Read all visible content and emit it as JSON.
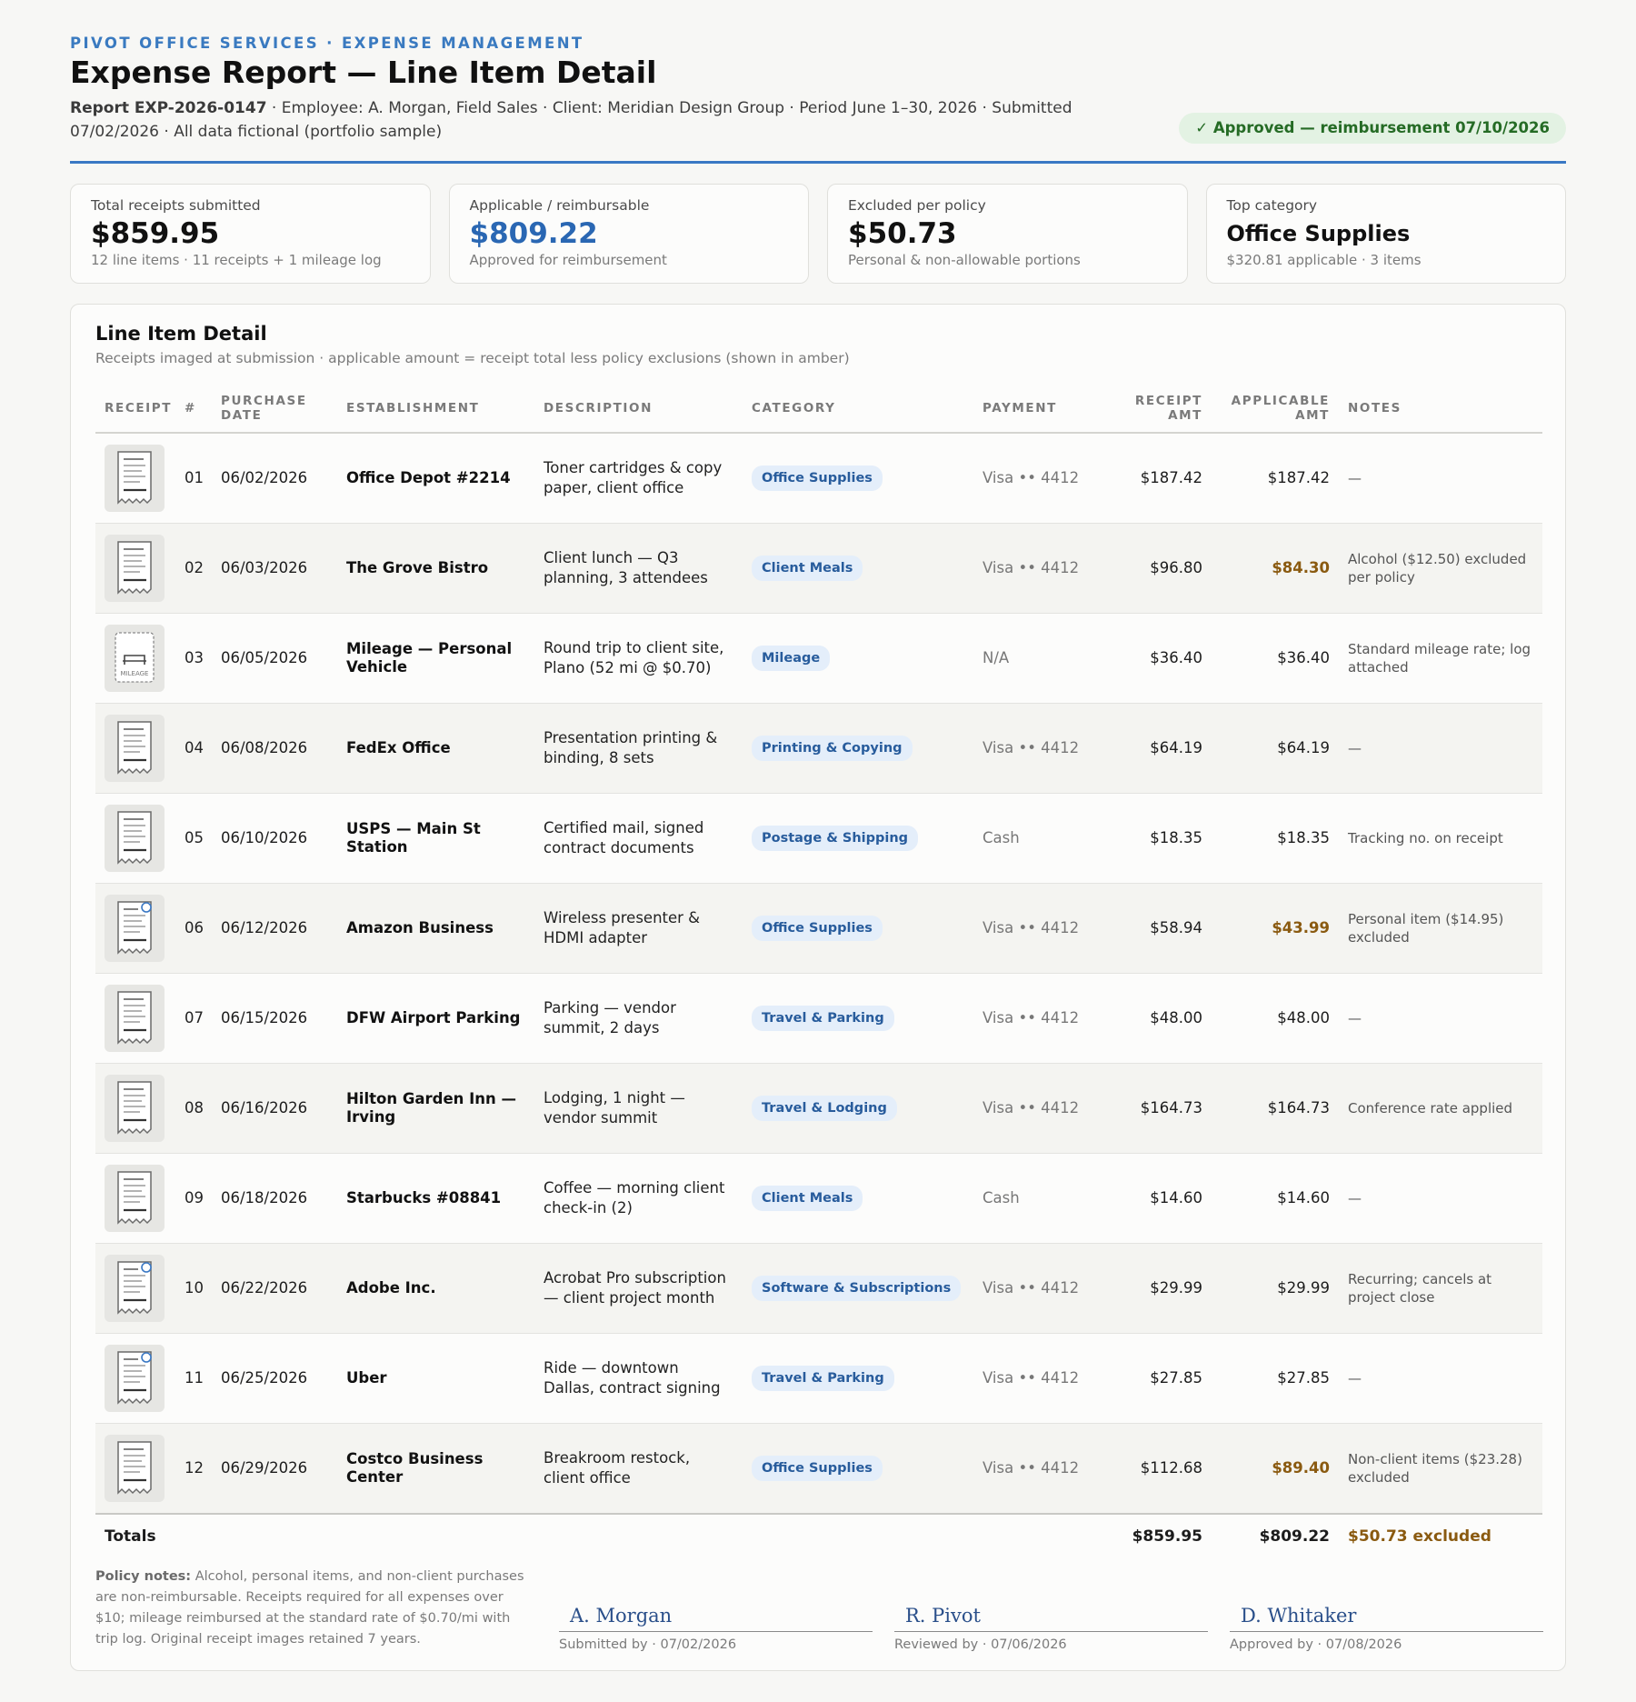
{
  "header": {
    "kicker": "PIVOT OFFICE SERVICES · EXPENSE MANAGEMENT",
    "title": "Expense Report — Line Item Detail",
    "report_id": "Report EXP-2026-0147",
    "meta_rest": " · Employee: A. Morgan, Field Sales · Client: Meridian Design Group · Period June 1–30, 2026 · Submitted 07/02/2026 · All data fictional (portfolio sample)",
    "status": "✓ Approved — reimbursement 07/10/2026"
  },
  "cards": [
    {
      "label": "Total receipts submitted",
      "value": "$859.95",
      "sub": "12 line items · 11 receipts + 1 mileage log"
    },
    {
      "label": "Applicable / reimbursable",
      "value": "$809.22",
      "sub": "Approved for reimbursement"
    },
    {
      "label": "Excluded per policy",
      "value": "$50.73",
      "sub": "Personal & non-allowable portions"
    },
    {
      "label": "Top category",
      "value": "Office Supplies",
      "sub": "$320.81 applicable · 3 items"
    }
  ],
  "panel": {
    "title": "Line Item Detail",
    "subtitle": "Receipts imaged at submission · applicable amount = receipt total less policy exclusions (shown in amber)"
  },
  "columns": {
    "receipt": "RECEIPT",
    "num": "#",
    "date": "PURCHASE DATE",
    "establishment": "ESTABLISHMENT",
    "description": "DESCRIPTION",
    "category": "CATEGORY",
    "payment": "PAYMENT",
    "receipt_amt": "RECEIPT AMT",
    "applicable_amt": "APPLICABLE AMT",
    "notes": "NOTES"
  },
  "rows": [
    {
      "num": "01",
      "date": "06/02/2026",
      "establishment": "Office Depot #2214",
      "description": "Toner cartridges & copy paper, client office",
      "category": "Office Supplies",
      "payment": "Visa •• 4412",
      "receipt_amt": "$187.42",
      "applicable_amt": "$187.42",
      "notes": "—"
    },
    {
      "num": "02",
      "date": "06/03/2026",
      "establishment": "The Grove Bistro",
      "description": "Client lunch — Q3 planning, 3 attendees",
      "category": "Client Meals",
      "payment": "Visa •• 4412",
      "receipt_amt": "$96.80",
      "applicable_amt": "$84.30",
      "notes": "Alcohol ($12.50) excluded per policy"
    },
    {
      "num": "03",
      "date": "06/05/2026",
      "establishment": "Mileage — Personal Vehicle",
      "description": "Round trip to client site, Plano (52 mi @ $0.70)",
      "category": "Mileage",
      "payment": "N/A",
      "receipt_amt": "$36.40",
      "applicable_amt": "$36.40",
      "notes": "Standard mileage rate; log attached",
      "thumb_label": "MILEAGE"
    },
    {
      "num": "04",
      "date": "06/08/2026",
      "establishment": "FedEx Office",
      "description": "Presentation printing & binding, 8 sets",
      "category": "Printing & Copying",
      "payment": "Visa •• 4412",
      "receipt_amt": "$64.19",
      "applicable_amt": "$64.19",
      "notes": "—"
    },
    {
      "num": "05",
      "date": "06/10/2026",
      "establishment": "USPS — Main St Station",
      "description": "Certified mail, signed contract documents",
      "category": "Postage & Shipping",
      "payment": "Cash",
      "receipt_amt": "$18.35",
      "applicable_amt": "$18.35",
      "notes": "Tracking no. on receipt"
    },
    {
      "num": "06",
      "date": "06/12/2026",
      "establishment": "Amazon Business",
      "description": "Wireless presenter & HDMI adapter",
      "category": "Office Supplies",
      "payment": "Visa •• 4412",
      "receipt_amt": "$58.94",
      "applicable_amt": "$43.99",
      "notes": "Personal item ($14.95) excluded"
    },
    {
      "num": "07",
      "date": "06/15/2026",
      "establishment": "DFW Airport Parking",
      "description": "Parking — vendor summit, 2 days",
      "category": "Travel & Parking",
      "payment": "Visa •• 4412",
      "receipt_amt": "$48.00",
      "applicable_amt": "$48.00",
      "notes": "—"
    },
    {
      "num": "08",
      "date": "06/16/2026",
      "establishment": "Hilton Garden Inn — Irving",
      "description": "Lodging, 1 night — vendor summit",
      "category": "Travel & Lodging",
      "payment": "Visa •• 4412",
      "receipt_amt": "$164.73",
      "applicable_amt": "$164.73",
      "notes": "Conference rate applied"
    },
    {
      "num": "09",
      "date": "06/18/2026",
      "establishment": "Starbucks #08841",
      "description": "Coffee — morning client check-in (2)",
      "category": "Client Meals",
      "payment": "Cash",
      "receipt_amt": "$14.60",
      "applicable_amt": "$14.60",
      "notes": "—"
    },
    {
      "num": "10",
      "date": "06/22/2026",
      "establishment": "Adobe Inc.",
      "description": "Acrobat Pro subscription — client project month",
      "category": "Software & Subscriptions",
      "payment": "Visa •• 4412",
      "receipt_amt": "$29.99",
      "applicable_amt": "$29.99",
      "notes": "Recurring; cancels at project close"
    },
    {
      "num": "11",
      "date": "06/25/2026",
      "establishment": "Uber",
      "description": "Ride — downtown Dallas, contract signing",
      "category": "Travel & Parking",
      "payment": "Visa •• 4412",
      "receipt_amt": "$27.85",
      "applicable_amt": "$27.85",
      "notes": "—"
    },
    {
      "num": "12",
      "date": "06/29/2026",
      "establishment": "Costco Business Center",
      "description": "Breakroom restock, client office",
      "category": "Office Supplies",
      "payment": "Visa •• 4412",
      "receipt_amt": "$112.68",
      "applicable_amt": "$89.40",
      "notes": "Non-client items ($23.28) excluded"
    }
  ],
  "totals": {
    "label": "Totals",
    "receipt_amt": "$859.95",
    "applicable_amt": "$809.22",
    "excluded": "$50.73 excluded"
  },
  "policy": {
    "label": "Policy notes:",
    "text": " Alcohol, personal items, and non-client purchases are non-reimbursable. Receipts required for all expenses over $10; mileage reimbursed at the standard rate of $0.70/mi with trip log. Original receipt images retained 7 years."
  },
  "signatures": [
    {
      "name": "A. Morgan",
      "caption": "Submitted by · 07/02/2026"
    },
    {
      "name": "R. Pivot",
      "caption": "Reviewed by · 07/06/2026"
    },
    {
      "name": "D. Whitaker",
      "caption": "Approved by · 07/08/2026"
    }
  ],
  "colors": {
    "accent": "#3a78c4",
    "amber": "#8a5a10",
    "approved_bg": "#e3f2e3",
    "approved_text": "#256b25",
    "pill_bg": "#e4eefa",
    "pill_text": "#285c9c"
  },
  "icons": {
    "receipt": "receipt-thumbnail-icon",
    "mileage": "car-seat-icon",
    "status": "check-icon"
  }
}
